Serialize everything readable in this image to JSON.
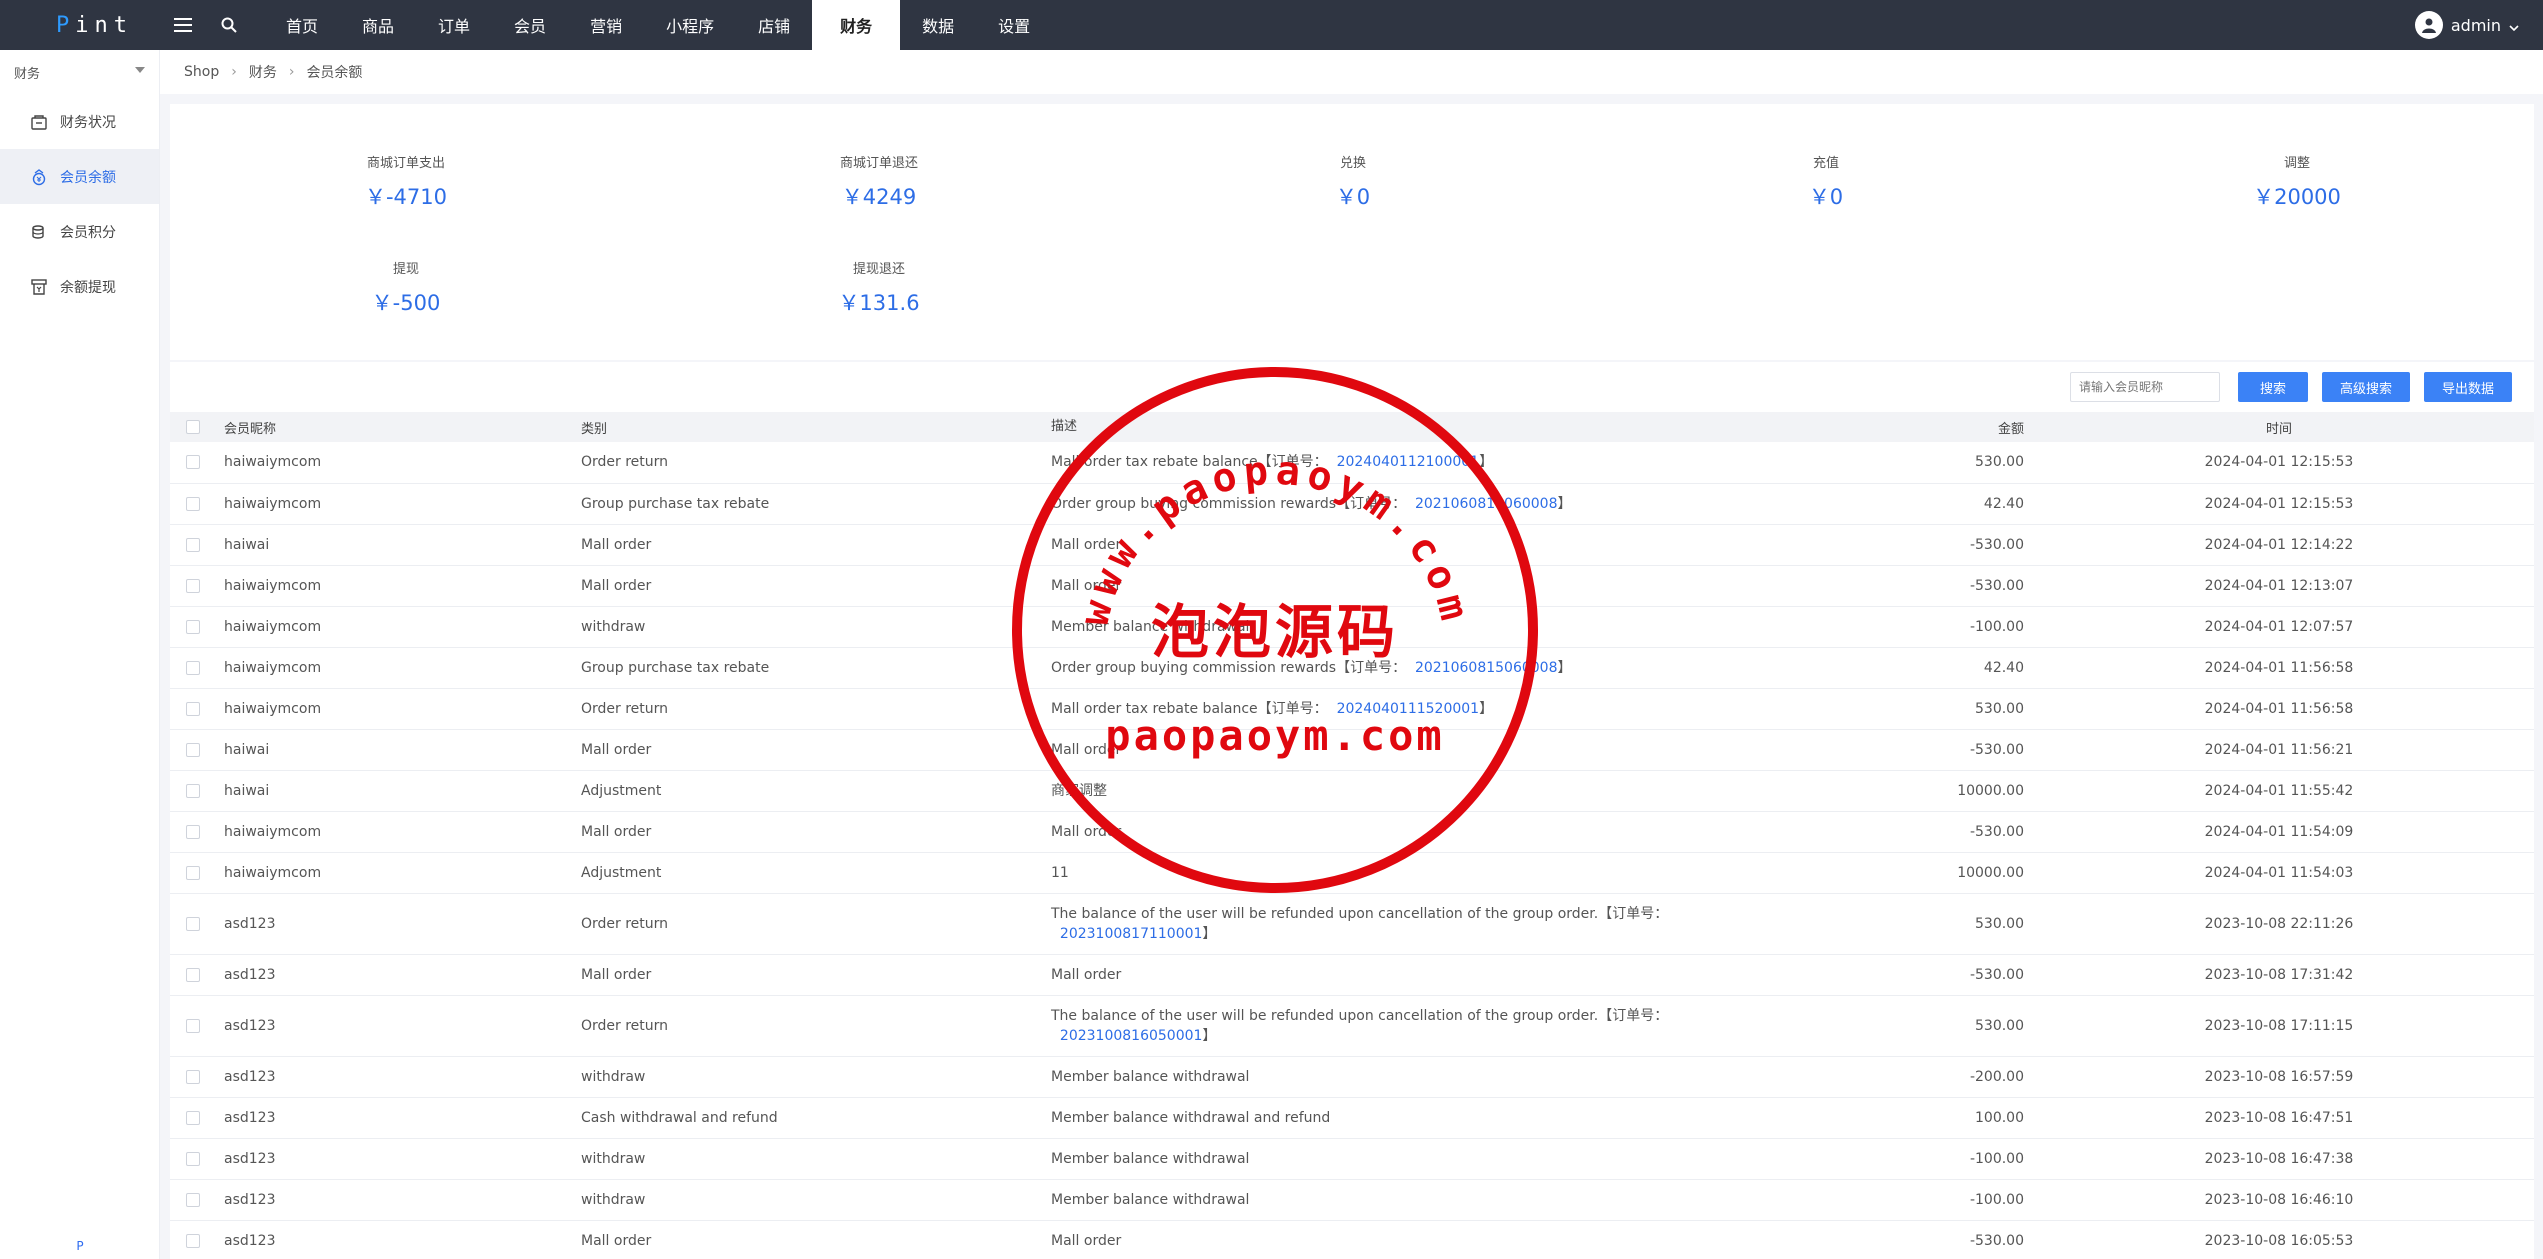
{
  "app": {
    "logo_first": "P",
    "logo_rest": "int"
  },
  "nav": [
    {
      "label": "首页"
    },
    {
      "label": "商品"
    },
    {
      "label": "订单"
    },
    {
      "label": "会员"
    },
    {
      "label": "营销"
    },
    {
      "label": "小程序"
    },
    {
      "label": "店铺"
    },
    {
      "label": "财务",
      "active": true
    },
    {
      "label": "数据"
    },
    {
      "label": "设置"
    }
  ],
  "user": {
    "name": "admin"
  },
  "sidebar": {
    "head": "财务",
    "items": [
      {
        "label": "财务状况",
        "icon": "finance-icon"
      },
      {
        "label": "会员余额",
        "icon": "wallet-icon",
        "active": true
      },
      {
        "label": "会员积分",
        "icon": "points-icon"
      },
      {
        "label": "余额提现",
        "icon": "withdraw-icon"
      }
    ],
    "footer": "P"
  },
  "breadcrumb": [
    "Shop",
    "财务",
    "会员余额"
  ],
  "summary": [
    {
      "label": "商城订单支出",
      "value": "￥-4710"
    },
    {
      "label": "商城订单退还",
      "value": "￥4249"
    },
    {
      "label": "兑换",
      "value": "￥0"
    },
    {
      "label": "充值",
      "value": "￥0"
    },
    {
      "label": "调整",
      "value": "￥20000"
    },
    {
      "label": "提现",
      "value": "￥-500"
    },
    {
      "label": "提现退还",
      "value": "￥131.6"
    }
  ],
  "toolbar": {
    "search_placeholder": "请输入会员昵称",
    "search_btn": "搜索",
    "advanced_btn": "高级搜索",
    "export_btn": "导出数据"
  },
  "table": {
    "headers": [
      "会员昵称",
      "类别",
      "描述",
      "金额",
      "时间"
    ],
    "rows": [
      {
        "name": "haiwaiymcom",
        "type": "Order return",
        "desc": "Mall order tax rebate balance【订单号：",
        "order": "2024040112100001",
        "desc_end": "】",
        "amount": "530.00",
        "time": "2024-04-01 12:15:53"
      },
      {
        "name": "haiwaiymcom",
        "type": "Group purchase tax rebate",
        "desc": "Order group buying commission rewards【订单号：",
        "order": "2021060815060008",
        "desc_end": "】",
        "amount": "42.40",
        "time": "2024-04-01 12:15:53"
      },
      {
        "name": "haiwai",
        "type": "Mall order",
        "desc": "Mall order",
        "order": "",
        "desc_end": "",
        "amount": "-530.00",
        "time": "2024-04-01 12:14:22"
      },
      {
        "name": "haiwaiymcom",
        "type": "Mall order",
        "desc": "Mall order",
        "order": "",
        "desc_end": "",
        "amount": "-530.00",
        "time": "2024-04-01 12:13:07"
      },
      {
        "name": "haiwaiymcom",
        "type": "withdraw",
        "desc": "Member balance withdrawal",
        "order": "",
        "desc_end": "",
        "amount": "-100.00",
        "time": "2024-04-01 12:07:57"
      },
      {
        "name": "haiwaiymcom",
        "type": "Group purchase tax rebate",
        "desc": "Order group buying commission rewards【订单号：",
        "order": "2021060815060008",
        "desc_end": "】",
        "amount": "42.40",
        "time": "2024-04-01 11:56:58"
      },
      {
        "name": "haiwaiymcom",
        "type": "Order return",
        "desc": "Mall order tax rebate balance【订单号：",
        "order": "2024040111520001",
        "desc_end": "】",
        "amount": "530.00",
        "time": "2024-04-01 11:56:58"
      },
      {
        "name": "haiwai",
        "type": "Mall order",
        "desc": "Mall order",
        "order": "",
        "desc_end": "",
        "amount": "-530.00",
        "time": "2024-04-01 11:56:21"
      },
      {
        "name": "haiwai",
        "type": "Adjustment",
        "desc": "商家调整",
        "order": "",
        "desc_end": "",
        "amount": "10000.00",
        "time": "2024-04-01 11:55:42"
      },
      {
        "name": "haiwaiymcom",
        "type": "Mall order",
        "desc": "Mall order",
        "order": "",
        "desc_end": "",
        "amount": "-530.00",
        "time": "2024-04-01 11:54:09"
      },
      {
        "name": "haiwaiymcom",
        "type": "Adjustment",
        "desc": "11",
        "order": "",
        "desc_end": "",
        "amount": "10000.00",
        "time": "2024-04-01 11:54:03"
      },
      {
        "name": "asd123",
        "type": "Order return",
        "desc": "The balance of the user will be refunded upon cancellation of the group order.【订单号：",
        "order": "2023100817110001",
        "desc_end": "】",
        "amount": "530.00",
        "time": "2023-10-08 22:11:26",
        "wrap": true
      },
      {
        "name": "asd123",
        "type": "Mall order",
        "desc": "Mall order",
        "order": "",
        "desc_end": "",
        "amount": "-530.00",
        "time": "2023-10-08 17:31:42"
      },
      {
        "name": "asd123",
        "type": "Order return",
        "desc": "The balance of the user will be refunded upon cancellation of the group order.【订单号：",
        "order": "2023100816050001",
        "desc_end": "】",
        "amount": "530.00",
        "time": "2023-10-08 17:11:15",
        "wrap": true
      },
      {
        "name": "asd123",
        "type": "withdraw",
        "desc": "Member balance withdrawal",
        "order": "",
        "desc_end": "",
        "amount": "-200.00",
        "time": "2023-10-08 16:57:59"
      },
      {
        "name": "asd123",
        "type": "Cash withdrawal and refund",
        "desc": "Member balance withdrawal and refund",
        "order": "",
        "desc_end": "",
        "amount": "100.00",
        "time": "2023-10-08 16:47:51"
      },
      {
        "name": "asd123",
        "type": "withdraw",
        "desc": "Member balance withdrawal",
        "order": "",
        "desc_end": "",
        "amount": "-100.00",
        "time": "2023-10-08 16:47:38"
      },
      {
        "name": "asd123",
        "type": "withdraw",
        "desc": "Member balance withdrawal",
        "order": "",
        "desc_end": "",
        "amount": "-100.00",
        "time": "2023-10-08 16:46:10"
      },
      {
        "name": "asd123",
        "type": "Mall order",
        "desc": "Mall order",
        "order": "",
        "desc_end": "",
        "amount": "-530.00",
        "time": "2023-10-08 16:05:53"
      }
    ]
  },
  "watermark": {
    "arc_text": "www.paopaoym.com",
    "center_text": "泡泡源码",
    "bottom_text": "paopaoym.com",
    "color": "#e0080f"
  },
  "colors": {
    "topbar": "#2f3542",
    "accent": "#2d6de6",
    "button": "#3b82f6"
  }
}
